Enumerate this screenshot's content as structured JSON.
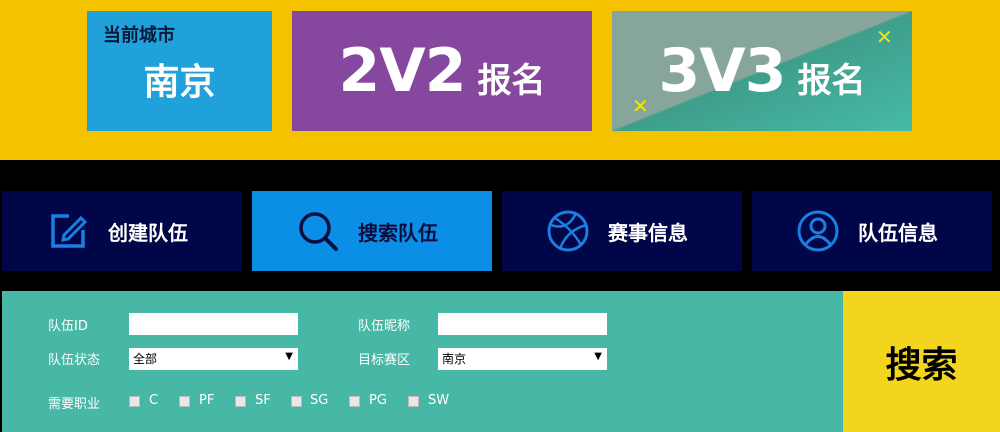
{
  "banner": {
    "city_label": "当前城市",
    "city_name": "南京",
    "reg_2v2": {
      "mode": "2V2",
      "word": "报名"
    },
    "reg_3v3": {
      "mode": "3V3",
      "word": "报名"
    },
    "accent_colors": {
      "banner_bg": "#f5c200",
      "city_card": "#21a1d9",
      "reg_2v2_bg": "#85489e",
      "reg_3v3_bg": "#46bba6",
      "x_mark": "#f2e600"
    }
  },
  "tabs": [
    {
      "label": "创建队伍",
      "icon": "edit-icon",
      "active": false
    },
    {
      "label": "搜索队伍",
      "icon": "search-icon",
      "active": true
    },
    {
      "label": "赛事信息",
      "icon": "basketball-icon",
      "active": false
    },
    {
      "label": "队伍信息",
      "icon": "user-icon",
      "active": false
    }
  ],
  "form": {
    "team_id_label": "队伍ID",
    "team_id_value": "",
    "team_nick_label": "队伍昵称",
    "team_nick_value": "",
    "team_status_label": "队伍状态",
    "team_status_value": "全部",
    "target_area_label": "目标赛区",
    "target_area_value": "南京",
    "positions_label": "需要职业",
    "positions": [
      "C",
      "PF",
      "SF",
      "SG",
      "PG",
      "SW"
    ]
  },
  "search_button": "搜索"
}
